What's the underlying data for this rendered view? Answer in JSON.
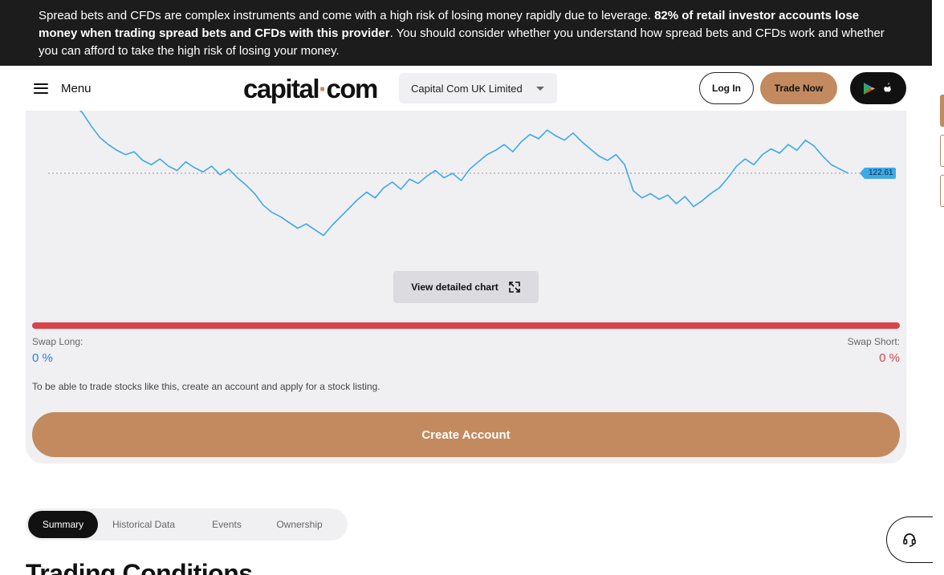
{
  "risk_banner": {
    "text_1": "Spread bets and CFDs are complex instruments and come with a high risk of losing money rapidly due to leverage. ",
    "text_bold": "82% of retail investor accounts lose money when trading spread bets and CFDs with this provider",
    "text_2": ". You should consider whether you understand how spread bets and CFDs work and whether you can afford to take the high risk of losing your money."
  },
  "header": {
    "menu_label": "Menu",
    "logo_part1": "capital",
    "logo_dot": "·",
    "logo_part2": "com",
    "entity_select": "Capital Com UK Limited",
    "login_label": "Log In",
    "trade_label": "Trade Now",
    "app_icons": [
      "google-play-icon",
      "apple-icon"
    ]
  },
  "chart_data": {
    "type": "line",
    "current_price_label": "122.61",
    "current_price": 122.61,
    "series": [
      {
        "values": [
          127.4,
          126.8,
          125.9,
          125.1,
          124.6,
          124.2,
          123.9,
          124.1,
          123.5,
          123.2,
          123.6,
          123.1,
          122.8,
          123.4,
          123.0,
          122.7,
          123.1,
          122.5,
          122.9,
          122.3,
          121.8,
          121.2,
          120.4,
          119.9,
          119.6,
          119.2,
          118.8,
          119.1,
          118.7,
          118.3,
          119.0,
          119.6,
          120.2,
          120.8,
          121.3,
          120.9,
          121.6,
          122.0,
          121.5,
          122.2,
          121.9,
          122.4,
          122.8,
          122.3,
          122.6,
          122.1,
          122.9,
          123.4,
          123.9,
          124.2,
          124.6,
          124.1,
          124.8,
          125.3,
          125.0,
          125.6,
          125.2,
          124.9,
          125.4,
          124.8,
          124.3,
          123.8,
          123.5,
          123.9,
          123.2,
          121.4,
          120.9,
          121.2,
          120.8,
          121.1,
          120.5,
          121.0,
          120.3,
          120.7,
          121.2,
          121.6,
          122.3,
          123.1,
          123.6,
          123.2,
          123.9,
          124.3,
          124.0,
          124.6,
          124.2,
          124.9,
          124.5,
          123.8,
          123.2,
          122.9,
          122.6
        ]
      }
    ],
    "color": "#3fa8e8"
  },
  "chart_card": {
    "view_chart_label": "View detailed chart",
    "swap_long_label": "Swap Long:",
    "swap_long_value": "0 %",
    "swap_short_label": "Swap Short:",
    "swap_short_value": "0 %",
    "notice": "To be able to trade stocks like this, create an account and apply for a stock listing.",
    "create_account_label": "Create Account"
  },
  "tabs": [
    {
      "label": "Summary",
      "active": true
    },
    {
      "label": "Historical Data",
      "active": false
    },
    {
      "label": "Events",
      "active": false
    },
    {
      "label": "Ownership",
      "active": false
    }
  ],
  "section_title": "Trading Conditions",
  "colors": {
    "brand": "#c28a5e",
    "line": "#3fa8e8",
    "swap_bar": "#d9434a",
    "swap_long": "#2f7de0",
    "swap_short": "#d9434a"
  }
}
